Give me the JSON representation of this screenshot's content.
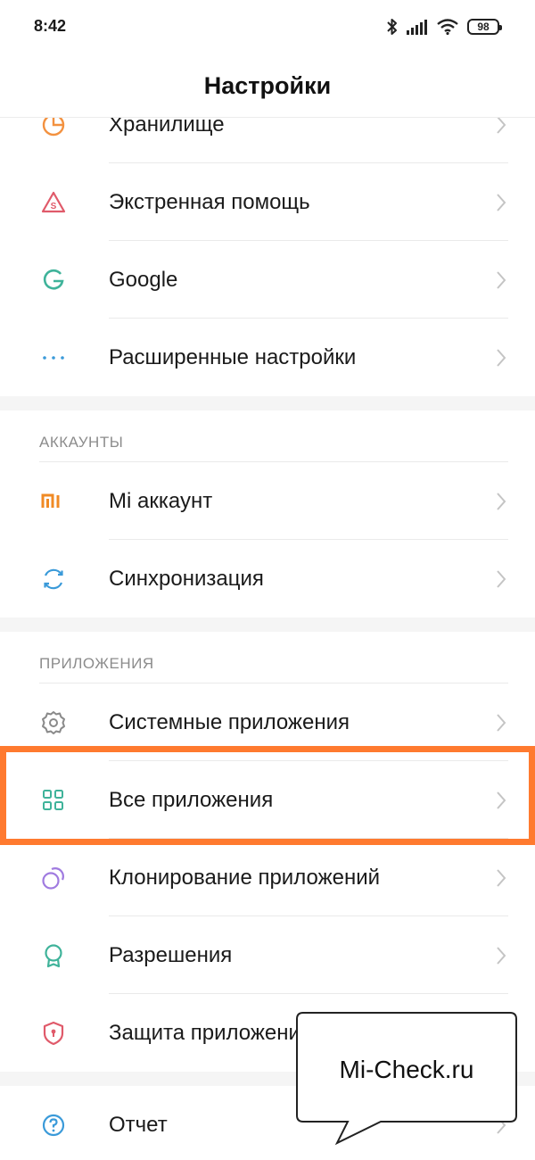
{
  "status_bar": {
    "time": "8:42",
    "battery": "98",
    "icons": [
      "bluetooth-icon",
      "signal-icon",
      "wifi-icon",
      "battery-icon"
    ]
  },
  "header": {
    "title": "Настройки"
  },
  "sections": [
    {
      "header": "",
      "items": [
        {
          "label": "Хранилище",
          "icon": "storage-pie-icon",
          "color": "#f3913f"
        },
        {
          "label": "Экстренная помощь",
          "icon": "sos-warning-icon",
          "color": "#e05a6a"
        },
        {
          "label": "Google",
          "icon": "google-icon",
          "color": "#3fb39a"
        },
        {
          "label": "Расширенные настройки",
          "icon": "more-dots-icon",
          "color": "#3a9ad9"
        }
      ]
    },
    {
      "header": "АККАУНТЫ",
      "items": [
        {
          "label": "Mi аккаунт",
          "icon": "mi-logo-icon",
          "color": "#f08a24"
        },
        {
          "label": "Синхронизация",
          "icon": "sync-icon",
          "color": "#3a9ad9"
        }
      ]
    },
    {
      "header": "ПРИЛОЖЕНИЯ",
      "items": [
        {
          "label": "Системные приложения",
          "icon": "gear-icon",
          "color": "#8a8a8a"
        },
        {
          "label": "Все приложения",
          "icon": "apps-grid-icon",
          "color": "#3fb39a"
        },
        {
          "label": "Клонирование приложений",
          "icon": "dual-apps-icon",
          "color": "#a07be0"
        },
        {
          "label": "Разрешения",
          "icon": "permissions-badge-icon",
          "color": "#3fb39a"
        },
        {
          "label": "Защита приложений",
          "icon": "shield-lock-icon",
          "color": "#e05a6a"
        }
      ]
    },
    {
      "header": "",
      "items": [
        {
          "label": "Отчет",
          "icon": "help-question-icon",
          "color": "#3a9ad9"
        }
      ]
    }
  ],
  "highlight": {
    "color": "#ff7a2f"
  },
  "callout": {
    "text": "Mi-Check.ru"
  }
}
